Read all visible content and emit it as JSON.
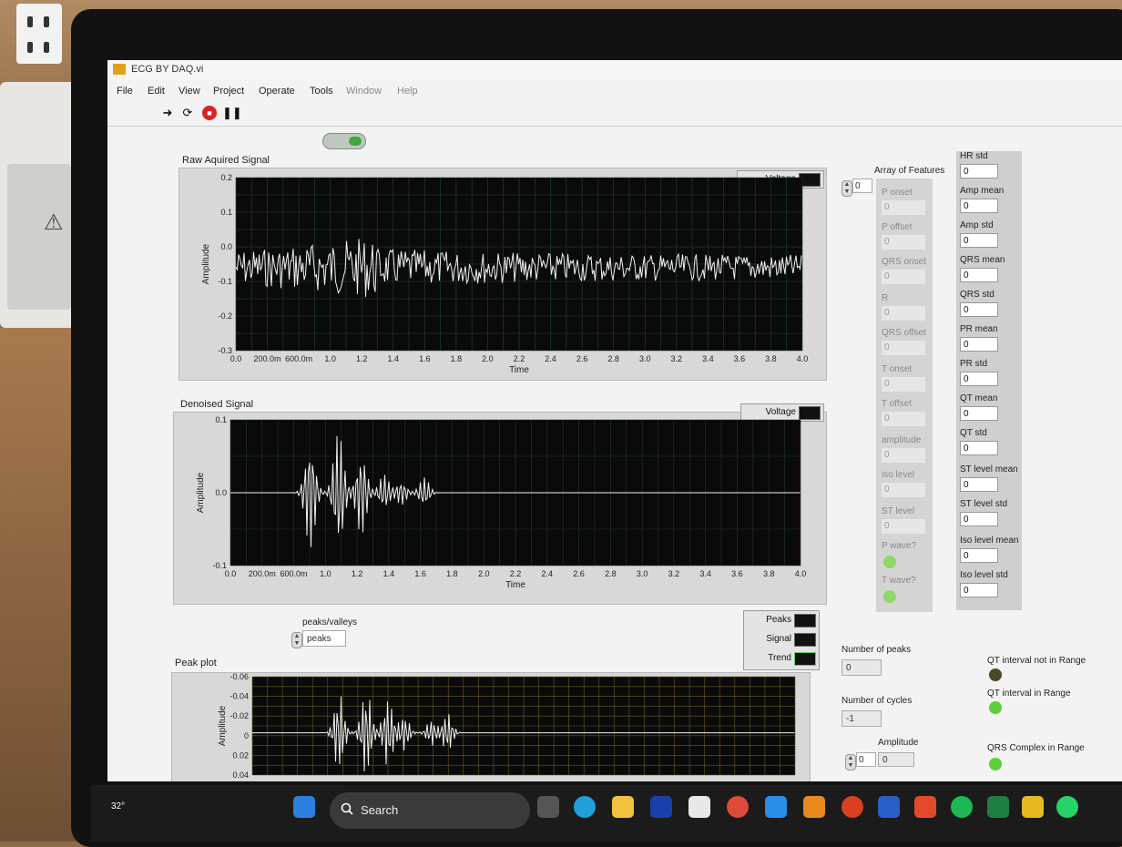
{
  "window": {
    "title": "ECG BY DAQ.vi"
  },
  "menu": [
    "File",
    "Edit",
    "View",
    "Project",
    "Operate",
    "Tools",
    "Window",
    "Help"
  ],
  "plots": {
    "raw": {
      "title": "Raw Aquired Signal",
      "legend": "Voltage",
      "ylabel": "Amplitude",
      "xlabel": "Time",
      "yticks": [
        "0.2",
        "0.1",
        "0.0",
        "-0.1",
        "-0.2",
        "-0.3"
      ],
      "xticks": [
        "0.0",
        "200.0m",
        "600.0m",
        "1.0",
        "1.2",
        "1.4",
        "1.6",
        "1.8",
        "2.0",
        "2.2",
        "2.4",
        "2.6",
        "2.8",
        "3.0",
        "3.2",
        "3.4",
        "3.6",
        "3.8",
        "4.0"
      ]
    },
    "denoised": {
      "title": "Denoised Signal",
      "legend": "Voltage",
      "ylabel": "Amplitude",
      "xlabel": "Time",
      "yticks": [
        "0.1",
        "0.0",
        "-0.1"
      ],
      "xticks": [
        "0.0",
        "200.0m",
        "600.0m",
        "1.0",
        "1.2",
        "1.4",
        "1.6",
        "1.8",
        "2.0",
        "2.2",
        "2.4",
        "2.6",
        "2.8",
        "3.0",
        "3.2",
        "3.4",
        "3.6",
        "3.8",
        "4.0"
      ]
    },
    "peak": {
      "title": "Peak plot",
      "ylabel": "Amplitude",
      "yticks": [
        "-0.06",
        "-0.04",
        "-0.02",
        "0",
        "0.02",
        "0.04"
      ],
      "legend": [
        "Peaks",
        "Signal",
        "Trend"
      ]
    }
  },
  "peaks_selector": {
    "label": "peaks/valleys",
    "value": "peaks"
  },
  "features": {
    "title": "Array of Features",
    "index": "0",
    "items": [
      {
        "label": "P onset",
        "value": "0"
      },
      {
        "label": "P offset",
        "value": "0"
      },
      {
        "label": "QRS onset",
        "value": "0"
      },
      {
        "label": "R",
        "value": "0"
      },
      {
        "label": "QRS offset",
        "value": "0"
      },
      {
        "label": "T onset",
        "value": "0"
      },
      {
        "label": "T offset",
        "value": "0"
      },
      {
        "label": "amplitude",
        "value": "0"
      },
      {
        "label": "iso level",
        "value": "0"
      },
      {
        "label": "ST level",
        "value": "0"
      }
    ],
    "leds": [
      {
        "label": "P wave?"
      },
      {
        "label": "T wave?"
      }
    ]
  },
  "stats": [
    {
      "label": "HR std",
      "value": "0"
    },
    {
      "label": "Amp mean",
      "value": "0"
    },
    {
      "label": "Amp std",
      "value": "0"
    },
    {
      "label": "QRS mean",
      "value": "0"
    },
    {
      "label": "QRS std",
      "value": "0"
    },
    {
      "label": "PR mean",
      "value": "0"
    },
    {
      "label": "PR std",
      "value": "0"
    },
    {
      "label": "QT mean",
      "value": "0"
    },
    {
      "label": "QT std",
      "value": "0"
    },
    {
      "label": "ST level mean",
      "value": "0"
    },
    {
      "label": "ST level std",
      "value": "0"
    },
    {
      "label": "Iso level mean",
      "value": "0"
    },
    {
      "label": "Iso level std",
      "value": "0"
    }
  ],
  "num_peaks": {
    "label": "Number of peaks",
    "value": "0"
  },
  "num_cycles": {
    "label": "Number of cycles",
    "value": "-1"
  },
  "amplitude": {
    "label": "Amplitude",
    "index": "0",
    "value": "0"
  },
  "indicators": [
    {
      "label": "QT interval not in Range",
      "color": "#4a4a2a"
    },
    {
      "label": "QT interval in Range",
      "color": "#5ccf3a"
    },
    {
      "label": "QRS Complex in Range",
      "color": "#5ccf3a"
    }
  ],
  "taskbar": {
    "search_placeholder": "Search",
    "weather": "32°"
  }
}
